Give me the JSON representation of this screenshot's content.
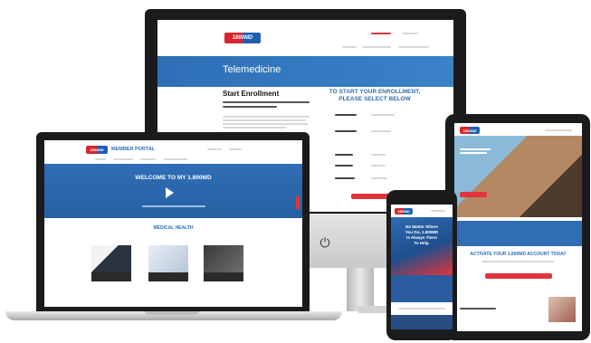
{
  "brand": {
    "logo_text": "1800MD",
    "accent_red": "#d7262e",
    "accent_blue": "#2f6db5"
  },
  "monitor": {
    "banner_title": "Telemedicine",
    "start_heading": "Start Enrollment",
    "cta_heading_line1": "TO START YOUR ENROLLMENT,",
    "cta_heading_line2": "PLEASE SELECT BELOW",
    "power_icon": "power-icon"
  },
  "laptop": {
    "portal_title": "MEMBER PORTAL",
    "hero_title": "WELCOME TO MY 1.800MD",
    "section_title": "MEDICAL HEALTH",
    "play_icon": "play-icon"
  },
  "tablet": {
    "activate_heading": "ACTIVATE YOUR 1.800MD ACCOUNT TODAY"
  },
  "phone": {
    "hero_line1": "No Matter Where",
    "hero_line2": "You Go, 1.800MD",
    "hero_line3": "Is Always There",
    "hero_line4": "To Help."
  }
}
